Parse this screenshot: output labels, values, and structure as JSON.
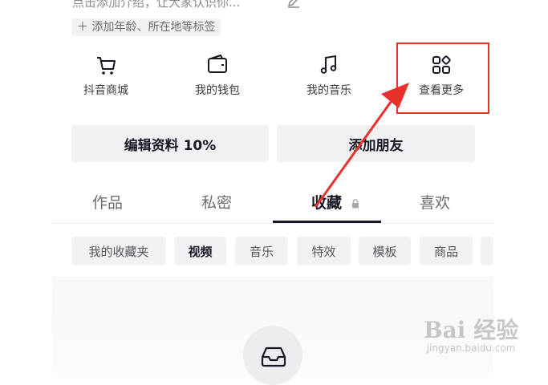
{
  "profile": {
    "intro_text": "点击添加介绍，让大家认识你...",
    "tag_add": "＋ 添加年龄、所在地等标签"
  },
  "shortcuts": [
    {
      "label": "抖音商城",
      "icon": "cart-icon"
    },
    {
      "label": "我的钱包",
      "icon": "wallet-icon"
    },
    {
      "label": "我的音乐",
      "icon": "music-note-icon"
    },
    {
      "label": "查看更多",
      "icon": "grid-more-icon"
    }
  ],
  "actions": {
    "edit_profile": "编辑资料 10%",
    "add_friends": "添加朋友"
  },
  "tabs": [
    {
      "label": "作品"
    },
    {
      "label": "私密"
    },
    {
      "label": "收藏",
      "active": true,
      "locked": true
    },
    {
      "label": "喜欢"
    }
  ],
  "chips": [
    {
      "label": "我的收藏夹"
    },
    {
      "label": "视频",
      "active": true
    },
    {
      "label": "音乐"
    },
    {
      "label": "特效"
    },
    {
      "label": "模板"
    },
    {
      "label": "商品"
    }
  ],
  "watermark": {
    "main": "Bai 经验",
    "sub": "jingyan.baidu.com"
  },
  "colors": {
    "highlight": "#e8312b",
    "chip_bg": "#f2f2f4",
    "button_bg": "#f1f1f3"
  }
}
